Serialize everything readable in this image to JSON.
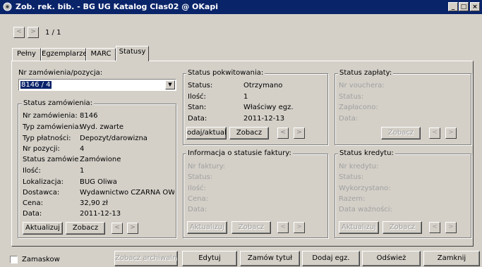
{
  "window": {
    "title": "Zob. rek. bib. - BG UG Katalog Clas02 @ OKapi",
    "min": "_",
    "max": "□",
    "close": "×"
  },
  "nav": {
    "prev": "<",
    "next": ">",
    "page": "1 / 1"
  },
  "tabs": [
    "Pełny",
    "Egzemplarze",
    "MARC",
    "Statusy"
  ],
  "order": {
    "label": "Nr zamówienia/pozycja:",
    "value": "8146 / 4",
    "status_group": "Status zamówienia:",
    "rows": [
      {
        "label": "Nr zamówienia:",
        "value": "8146"
      },
      {
        "label": "Typ zamówienia:",
        "value": "Wyd. zwarte"
      },
      {
        "label": "Typ płatności:",
        "value": "Depozyt/darowizna"
      },
      {
        "label": "Nr pozycji:",
        "value": "4"
      },
      {
        "label": "Status zamówien",
        "value": "Zamówione"
      },
      {
        "label": "Ilość:",
        "value": "1"
      },
      {
        "label": "Lokalizacja:",
        "value": "BUG Oliwa"
      },
      {
        "label": "Dostawca:",
        "value": "Wydawnictwo CZARNA OWC."
      },
      {
        "label": "Cena:",
        "value": "32,90 zł"
      },
      {
        "label": "Data:",
        "value": "2011-12-13"
      }
    ],
    "update": "Aktualizuj",
    "view": "Zobacz"
  },
  "receipt": {
    "title": "Status pokwitowania:",
    "rows": [
      {
        "label": "Status:",
        "value": "Otrzymano"
      },
      {
        "label": "Ilość:",
        "value": "1"
      },
      {
        "label": "Stan:",
        "value": "Właściwy egz."
      },
      {
        "label": "Data:",
        "value": "2011-12-13"
      }
    ],
    "update": "odaj/aktualiz",
    "view": "Zobacz"
  },
  "payment": {
    "title": "Status zapłaty:",
    "labels": [
      "Nr vouchera:",
      "Status:",
      "Zapłacono:",
      "Data:"
    ],
    "view": "Zobacz"
  },
  "invoice": {
    "title": "Informacja o statusie faktury:",
    "labels": [
      "Nr faktury:",
      "Status:",
      "Ilość:",
      "Cena:",
      "Data:"
    ],
    "update": "Aktualizuj",
    "view": "Zobacz"
  },
  "credit": {
    "title": "Status kredytu:",
    "labels": [
      "Nr kredytu:",
      "Status:",
      "Wykorzystano:",
      "Razem:",
      "Data ważności:"
    ],
    "update": "Aktualizuj",
    "view": "Zobacz"
  },
  "bottom": {
    "mask": "Zamaskow",
    "archive": "Zobacz archiwalny",
    "edit": "Edytuj",
    "order_title": "Zamów tytuł",
    "add_copy": "Dodaj egz.",
    "refresh": "Odśwież",
    "close": "Zamknij"
  }
}
